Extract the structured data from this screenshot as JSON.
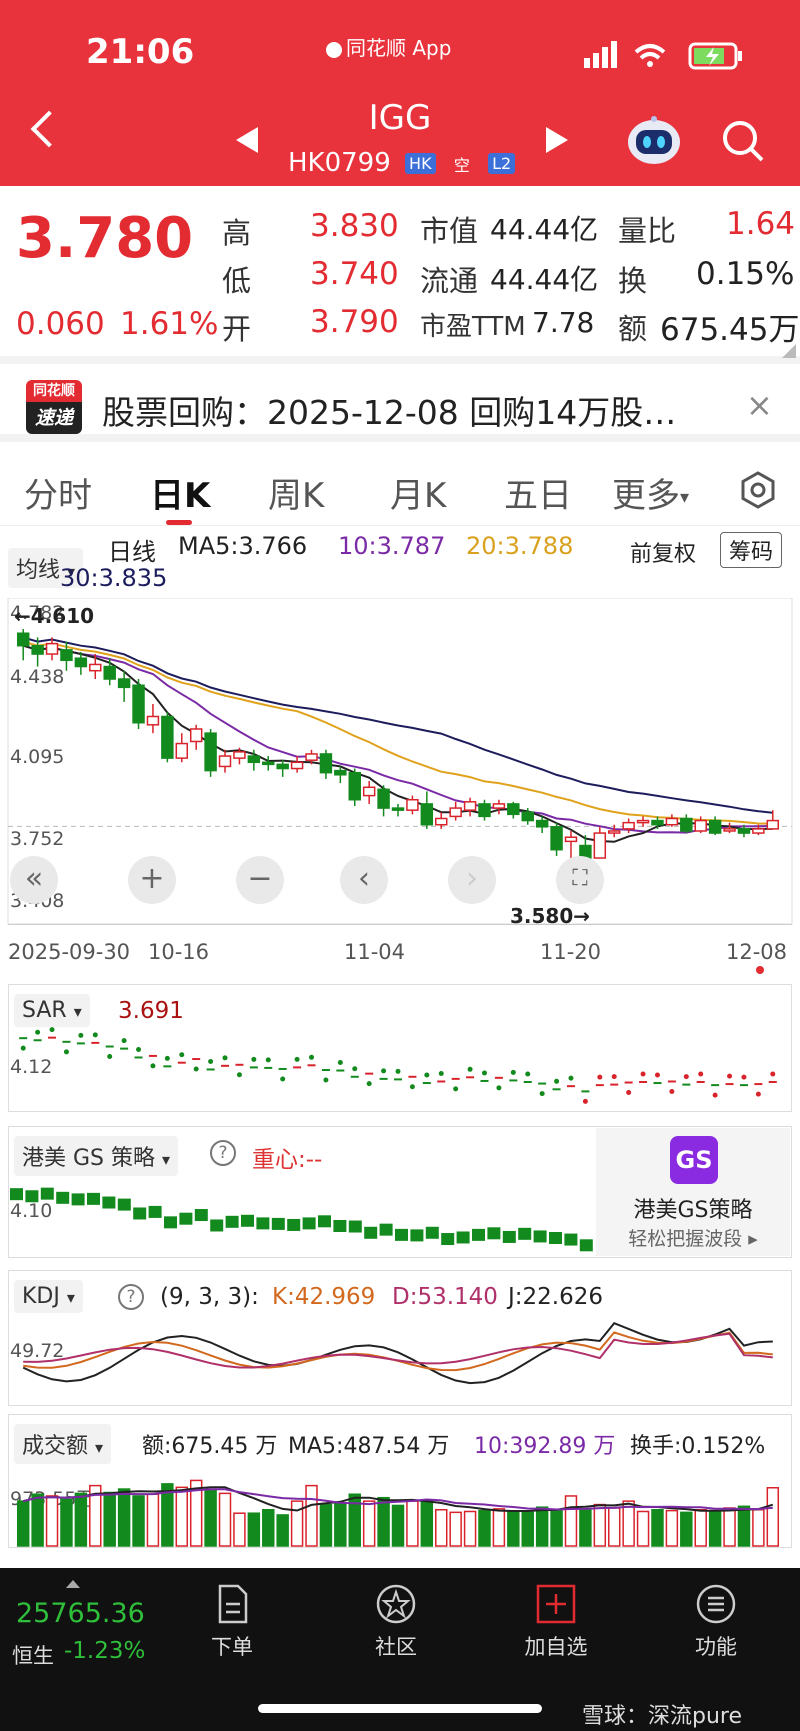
{
  "status_bar": {
    "time": "21:06",
    "app_name": "同花顺 App"
  },
  "header": {
    "title": "IGG",
    "code": "HK0799",
    "tags": [
      "HK",
      "空",
      "L2"
    ]
  },
  "quote": {
    "price": "3.780",
    "change": "0.060",
    "change_pct": "1.61%",
    "high_label": "高",
    "high": "3.830",
    "low_label": "低",
    "low": "3.740",
    "open_label": "开",
    "open": "3.790",
    "mktcap_label": "市值",
    "mktcap": "44.44亿",
    "float_label": "流通",
    "float": "44.44亿",
    "pe_label": "市盈TTM",
    "pe": "7.78",
    "vol_ratio_label": "量比",
    "vol_ratio": "1.64",
    "turnover_label": "换",
    "turnover": "0.15%",
    "amount_label": "额",
    "amount": "675.45万"
  },
  "news": {
    "badge_top": "同花顺",
    "badge_bottom": "速递",
    "text": "股票回购：2025-12-08 回购14万股…",
    "close": "×"
  },
  "tabs": [
    "分时",
    "日K",
    "周K",
    "月K",
    "五日",
    "更多"
  ],
  "active_tab": "日K",
  "kline": {
    "indicator_select": "均线",
    "line_label": "日线",
    "ma5": "MA5:3.766",
    "ma10": "10:3.787",
    "ma20": "20:3.788",
    "ma30": "30:3.835",
    "adjust": "前复权",
    "chip_button": "筹码",
    "y_ticks": [
      "4.782",
      "4.438",
      "4.095",
      "3.752",
      "3.408"
    ],
    "high_marker": "←4.610",
    "low_marker": "3.580→",
    "x_ticks": [
      "2025-09-30",
      "10-16",
      "11-04",
      "11-20",
      "12-08"
    ],
    "colors": {
      "up": "#d8232a",
      "down": "#138a1d",
      "ma5": "#222222",
      "ma10": "#7b2aa6",
      "ma20": "#e0a21c",
      "ma30": "#1d1d5e"
    }
  },
  "sar": {
    "label": "SAR",
    "value": "3.691",
    "y_tick": "4.12"
  },
  "gs": {
    "label": "港美 GS 策略",
    "center": "重心:--",
    "y_tick": "4.10",
    "promo_icon": "GS",
    "promo_title": "港美GS策略",
    "promo_sub": "轻松把握波段"
  },
  "kdj": {
    "label": "KDJ",
    "params": "(9, 3, 3):",
    "k": "K:42.969",
    "d": "D:53.140",
    "j": "J:22.626",
    "y_tick": "49.72"
  },
  "volume": {
    "label": "成交额",
    "amount": "额:675.45 万",
    "ma5": "MA5:487.54 万",
    "ma10": "10:392.89 万",
    "turnover": "换手:0.152%",
    "y_tick": "973.55万"
  },
  "bottom_nav": {
    "index_value": "25765.36",
    "index_name": "恒生",
    "index_change": "-1.23%",
    "items": [
      "下单",
      "社区",
      "加自选",
      "功能"
    ]
  },
  "watermark": "雪球：深流pure",
  "candles": [
    [
      4.68,
      4.62,
      4.7,
      4.55
    ],
    [
      4.62,
      4.58,
      4.66,
      4.52
    ],
    [
      4.58,
      4.63,
      4.66,
      4.55
    ],
    [
      4.6,
      4.55,
      4.64,
      4.5
    ],
    [
      4.56,
      4.52,
      4.59,
      4.48
    ],
    [
      4.5,
      4.53,
      4.58,
      4.46
    ],
    [
      4.52,
      4.46,
      4.56,
      4.43
    ],
    [
      4.46,
      4.42,
      4.5,
      4.35
    ],
    [
      4.43,
      4.25,
      4.46,
      4.22
    ],
    [
      4.24,
      4.28,
      4.34,
      4.2
    ],
    [
      4.28,
      4.08,
      4.3,
      4.06
    ],
    [
      4.08,
      4.15,
      4.2,
      4.06
    ],
    [
      4.16,
      4.22,
      4.24,
      4.12
    ],
    [
      4.2,
      4.02,
      4.22,
      3.99
    ],
    [
      4.04,
      4.09,
      4.12,
      4.01
    ],
    [
      4.08,
      4.11,
      4.13,
      4.05
    ],
    [
      4.09,
      4.06,
      4.12,
      4.02
    ],
    [
      4.06,
      4.05,
      4.09,
      4.02
    ],
    [
      4.05,
      4.03,
      4.07,
      3.99
    ],
    [
      4.03,
      4.06,
      4.09,
      4.01
    ],
    [
      4.07,
      4.1,
      4.12,
      4.05
    ],
    [
      4.1,
      4.01,
      4.12,
      3.98
    ],
    [
      4.02,
      4.0,
      4.04,
      3.96
    ],
    [
      4.01,
      3.88,
      4.03,
      3.85
    ],
    [
      3.9,
      3.94,
      3.97,
      3.86
    ],
    [
      3.93,
      3.84,
      3.95,
      3.8
    ],
    [
      3.84,
      3.83,
      3.86,
      3.8
    ],
    [
      3.83,
      3.88,
      3.9,
      3.81
    ],
    [
      3.86,
      3.76,
      3.92,
      3.74
    ],
    [
      3.76,
      3.79,
      3.82,
      3.74
    ],
    [
      3.8,
      3.84,
      3.87,
      3.78
    ],
    [
      3.83,
      3.87,
      3.89,
      3.8
    ],
    [
      3.86,
      3.8,
      3.88,
      3.78
    ],
    [
      3.84,
      3.86,
      3.88,
      3.81
    ],
    [
      3.86,
      3.81,
      3.87,
      3.79
    ],
    [
      3.82,
      3.78,
      3.84,
      3.76
    ],
    [
      3.78,
      3.75,
      3.8,
      3.72
    ],
    [
      3.75,
      3.64,
      3.77,
      3.61
    ],
    [
      3.68,
      3.7,
      3.73,
      3.58
    ],
    [
      3.66,
      3.6,
      3.71,
      3.58
    ],
    [
      3.6,
      3.72,
      3.75,
      3.6
    ],
    [
      3.72,
      3.73,
      3.76,
      3.7
    ],
    [
      3.74,
      3.77,
      3.79,
      3.72
    ],
    [
      3.77,
      3.78,
      3.8,
      3.75
    ],
    [
      3.78,
      3.76,
      3.8,
      3.74
    ],
    [
      3.76,
      3.79,
      3.81,
      3.75
    ],
    [
      3.79,
      3.73,
      3.81,
      3.72
    ],
    [
      3.73,
      3.78,
      3.8,
      3.72
    ],
    [
      3.78,
      3.72,
      3.8,
      3.71
    ],
    [
      3.73,
      3.74,
      3.77,
      3.72
    ],
    [
      3.74,
      3.72,
      3.76,
      3.7
    ],
    [
      3.72,
      3.74,
      3.76,
      3.71
    ],
    [
      3.74,
      3.78,
      3.83,
      3.74
    ]
  ],
  "volumes": [
    520,
    600,
    580,
    540,
    610,
    700,
    620,
    660,
    580,
    600,
    720,
    680,
    760,
    640,
    610,
    380,
    380,
    420,
    360,
    520,
    700,
    480,
    500,
    600,
    520,
    560,
    470,
    520,
    520,
    420,
    390,
    400,
    410,
    430,
    400,
    390,
    450,
    420,
    580,
    430,
    480,
    440,
    520,
    400,
    420,
    410,
    390,
    420,
    400,
    440,
    460,
    420,
    675
  ]
}
